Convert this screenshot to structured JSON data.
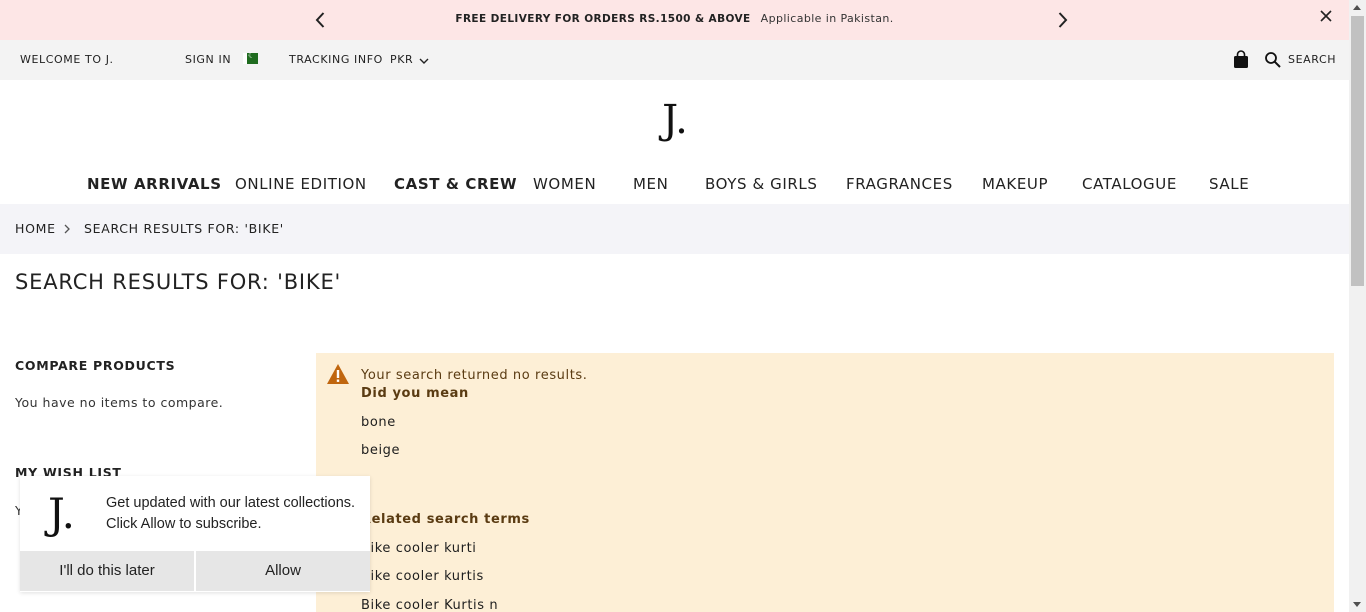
{
  "promo": {
    "headline": "FREE DELIVERY FOR ORDERS RS.1500 & ABOVE",
    "subline": "Applicable in Pakistan."
  },
  "utility": {
    "welcome": "WELCOME TO J.",
    "sign_in": "SIGN IN",
    "tracking": "TRACKING INFO",
    "currency": "PKR",
    "search_label": "SEARCH"
  },
  "logo": "J.",
  "nav": [
    {
      "label": "NEW ARRIVALS"
    },
    {
      "label": "ONLINE EDITION"
    },
    {
      "label": "CAST & CREW"
    },
    {
      "label": "WOMEN"
    },
    {
      "label": "MEN"
    },
    {
      "label": "BOYS & GIRLS"
    },
    {
      "label": "FRAGRANCES"
    },
    {
      "label": "MAKEUP"
    },
    {
      "label": "CATALOGUE"
    },
    {
      "label": "SALE"
    }
  ],
  "breadcrumb": {
    "home": "HOME",
    "current": "SEARCH RESULTS FOR: 'BIKE'"
  },
  "page_title": "SEARCH RESULTS FOR: 'BIKE'",
  "sidebar": {
    "compare_heading": "COMPARE PRODUCTS",
    "compare_text": "You have no items to compare.",
    "wishlist_heading": "MY WISH LIST",
    "wishlist_text": "Y"
  },
  "notice": {
    "message": "Your search returned no results.",
    "did_you_mean": "Did you mean",
    "suggestions": [
      "bone",
      "beige"
    ],
    "related_heading": "Related search terms",
    "related": [
      "Bike cooler kurti",
      "Bike cooler kurtis",
      "Bike cooler Kurtis n"
    ]
  },
  "popup": {
    "logo": "J.",
    "text": "Get updated with our latest collections. Click Allow to subscribe.",
    "later": "I'll do this later",
    "allow": "Allow"
  },
  "colors": {
    "promo_bg": "#fde6e6",
    "utility_bg": "#f3f3f3",
    "breadcrumb_bg": "#f4f4f8",
    "notice_bg": "#fdefd6",
    "warning": "#c0660f"
  }
}
